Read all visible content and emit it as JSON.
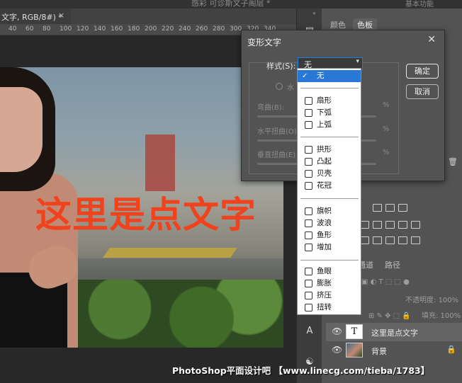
{
  "window": {
    "title": "感彩 可诊斯文子阁层 *",
    "top_right": "基本功能"
  },
  "document": {
    "tab_label": "文字, RGB/8#) *",
    "close_glyph": "×",
    "ruler_ticks": [
      "40",
      "60",
      "80",
      "100",
      "120",
      "140",
      "160",
      "180",
      "200",
      "220",
      "240",
      "260",
      "280",
      "300",
      "320",
      "340"
    ],
    "canvas_text": "这里是点文字"
  },
  "dialog": {
    "title": "变形文字",
    "close_glyph": "✕",
    "style_label": "样式(S):",
    "style_value": "无",
    "orientation_label": "水",
    "bend_label": "弯曲(B):",
    "hdistort_label": "水平扭曲(O)",
    "vdistort_label": "垂直扭曲(E)",
    "percent": "%",
    "ok_label": "确定",
    "cancel_label": "取消"
  },
  "dropdown": {
    "groups": [
      [
        "无"
      ],
      [
        "扇形",
        "下弧",
        "上弧"
      ],
      [
        "拱形",
        "凸起",
        "贝壳",
        "花冠"
      ],
      [
        "旗帜",
        "波浪",
        "鱼形",
        "增加"
      ],
      [
        "鱼眼",
        "膨胀",
        "挤压",
        "扭转"
      ]
    ],
    "selected": "无"
  },
  "panels": {
    "tabs": [
      "颜色",
      "色板"
    ],
    "layers_tabs": [
      "通道",
      "路径"
    ],
    "opacity_label": "不透明度:",
    "opacity_value": "100%",
    "fill_label": "填充:",
    "fill_value": "100%",
    "layers": [
      {
        "name": "这里是点文字",
        "type": "text",
        "thumb": "T"
      },
      {
        "name": "背景",
        "type": "image"
      }
    ]
  },
  "watermark": "PhotoShop平面设计吧 【www.linecg.com/tieba/1783】"
}
